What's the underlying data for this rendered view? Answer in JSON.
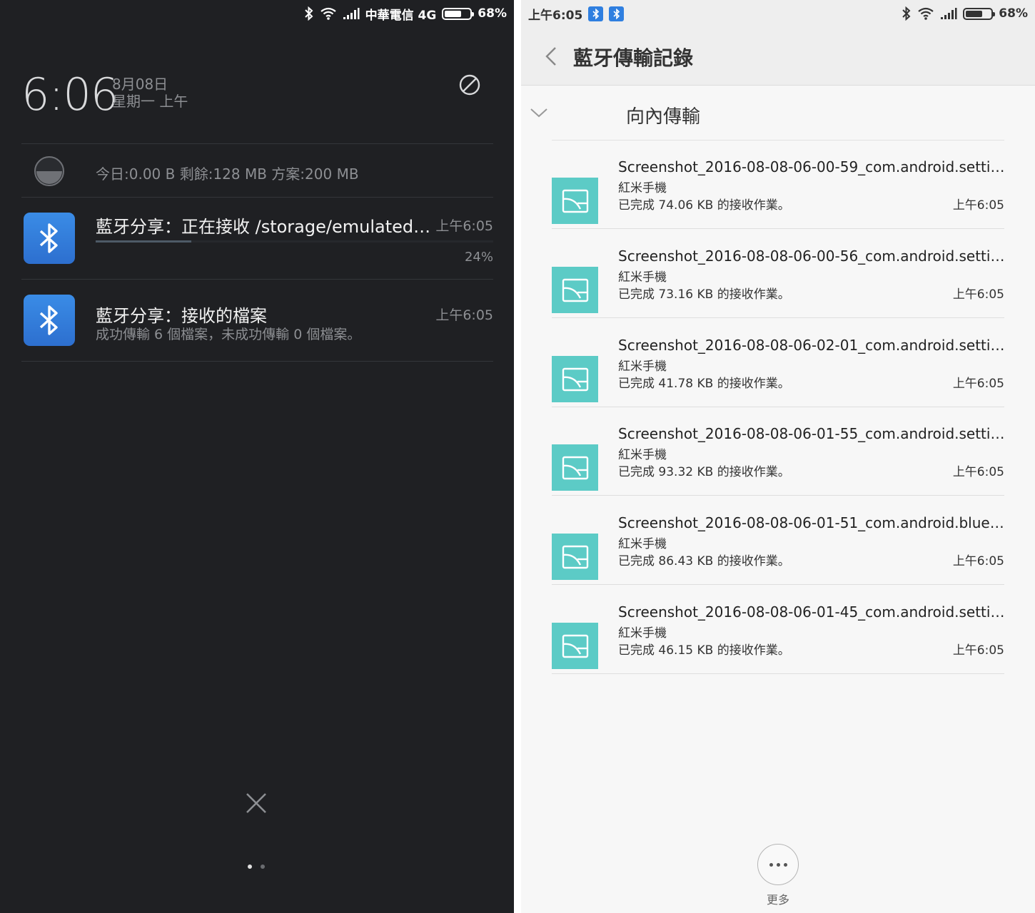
{
  "left": {
    "status_bar": {
      "carrier": "中華電信 4G",
      "battery": "68%",
      "battery_level": 0.68
    },
    "clock": {
      "time": "6:06",
      "date": "8月08日",
      "weekday": "星期一 上午"
    },
    "data_usage": "今日:0.00 B 剩餘:128 MB   方案:200 MB",
    "notifications": [
      {
        "title": "藍牙分享：正在接收 /storage/emulated/0..",
        "time": "上午6:05",
        "progress_percent": 24,
        "progress_label": "24%"
      },
      {
        "title": "藍牙分享：接收的檔案",
        "time": "上午6:05",
        "subtitle": "成功傳輸 6 個檔案，未成功傳輸 0 個檔案。"
      }
    ],
    "icons": [
      "bluetooth-icon",
      "wifi-icon",
      "signal-icon",
      "battery-icon",
      "do-not-disturb-icon",
      "data-usage-icon",
      "close-icon"
    ]
  },
  "right": {
    "status_bar": {
      "time": "上午6:05",
      "battery": "68%",
      "battery_level": 0.68
    },
    "title": "藍牙傳輸記錄",
    "section": "向內傳輸",
    "files": [
      {
        "name": "Screenshot_2016-08-08-06-00-59_com.android.settings...",
        "device": "紅米手機",
        "status": "已完成 74.06 KB 的接收作業。",
        "time": "上午6:05"
      },
      {
        "name": "Screenshot_2016-08-08-06-00-56_com.android.settings...",
        "device": "紅米手機",
        "status": "已完成 73.16 KB 的接收作業。",
        "time": "上午6:05"
      },
      {
        "name": "Screenshot_2016-08-08-06-02-01_com.android.settings...",
        "device": "紅米手機",
        "status": "已完成 41.78 KB 的接收作業。",
        "time": "上午6:05"
      },
      {
        "name": "Screenshot_2016-08-08-06-01-55_com.android.settings...",
        "device": "紅米手機",
        "status": "已完成 93.32 KB 的接收作業。",
        "time": "上午6:05"
      },
      {
        "name": "Screenshot_2016-08-08-06-01-51_com.android.bluetoot...",
        "device": "紅米手機",
        "status": "已完成 86.43 KB 的接收作業。",
        "time": "上午6:05"
      },
      {
        "name": "Screenshot_2016-08-08-06-01-45_com.android.settings...",
        "device": "紅米手機",
        "status": "已完成 46.15 KB 的接收作業。",
        "time": "上午6:05"
      }
    ],
    "more_label": "更多"
  },
  "colors": {
    "shade_bg": "#1f2023",
    "bluetooth_blue": "#2f7fe0",
    "thumb_teal": "#5ccbc6",
    "list_bg": "#f7f7f7"
  }
}
